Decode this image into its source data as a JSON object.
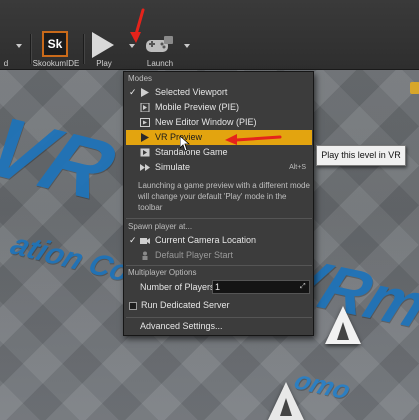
{
  "toolbar": {
    "buttons": [
      {
        "label": "SkookumIDE",
        "icon": "skookum-icon",
        "icon_text": "Sk"
      },
      {
        "label": "Play",
        "icon": "play-icon"
      },
      {
        "label": "Launch",
        "icon": "launch-controller-icon"
      }
    ],
    "left_fragment_label": "d"
  },
  "menu": {
    "sections": {
      "modes": "Modes",
      "spawn": "Spawn player at...",
      "multiplayer": "Multiplayer Options"
    },
    "mode_items": [
      {
        "label": "Selected Viewport",
        "checked": true,
        "icon": "viewport-play-icon"
      },
      {
        "label": "Mobile Preview (PIE)",
        "icon": "mobile-preview-icon"
      },
      {
        "label": "New Editor Window (PIE)",
        "icon": "new-window-icon"
      },
      {
        "label": "VR Preview",
        "icon": "vr-preview-icon",
        "highlighted": true
      },
      {
        "label": "Standalone Game",
        "icon": "standalone-game-icon"
      },
      {
        "label": "Simulate",
        "icon": "simulate-icon",
        "shortcut": "Alt+S"
      }
    ],
    "description": "Launching a game preview with a different mode will change your default 'Play' mode in the toolbar",
    "spawn_items": [
      {
        "label": "Current Camera Location",
        "checked": true,
        "icon": "camera-icon"
      },
      {
        "label": "Default Player Start",
        "icon": "player-start-icon",
        "disabled": true
      }
    ],
    "number_of_players_label": "Number of Players",
    "number_of_players_value": "1",
    "dedicated_server_label": "Run Dedicated Server",
    "dedicated_server_checked": false,
    "advanced_settings_label": "Advanced Settings..."
  },
  "tooltip": "Play this level in VR",
  "viewport": {
    "floor_text_1": "VR",
    "floor_text_2": "ation Com",
    "floor_text_3": "VRm",
    "floor_text_4": "omo"
  },
  "colors": {
    "highlight": "#e3a40f",
    "annotation_arrow": "#e5231b",
    "floor_text": "#1f73b8"
  }
}
